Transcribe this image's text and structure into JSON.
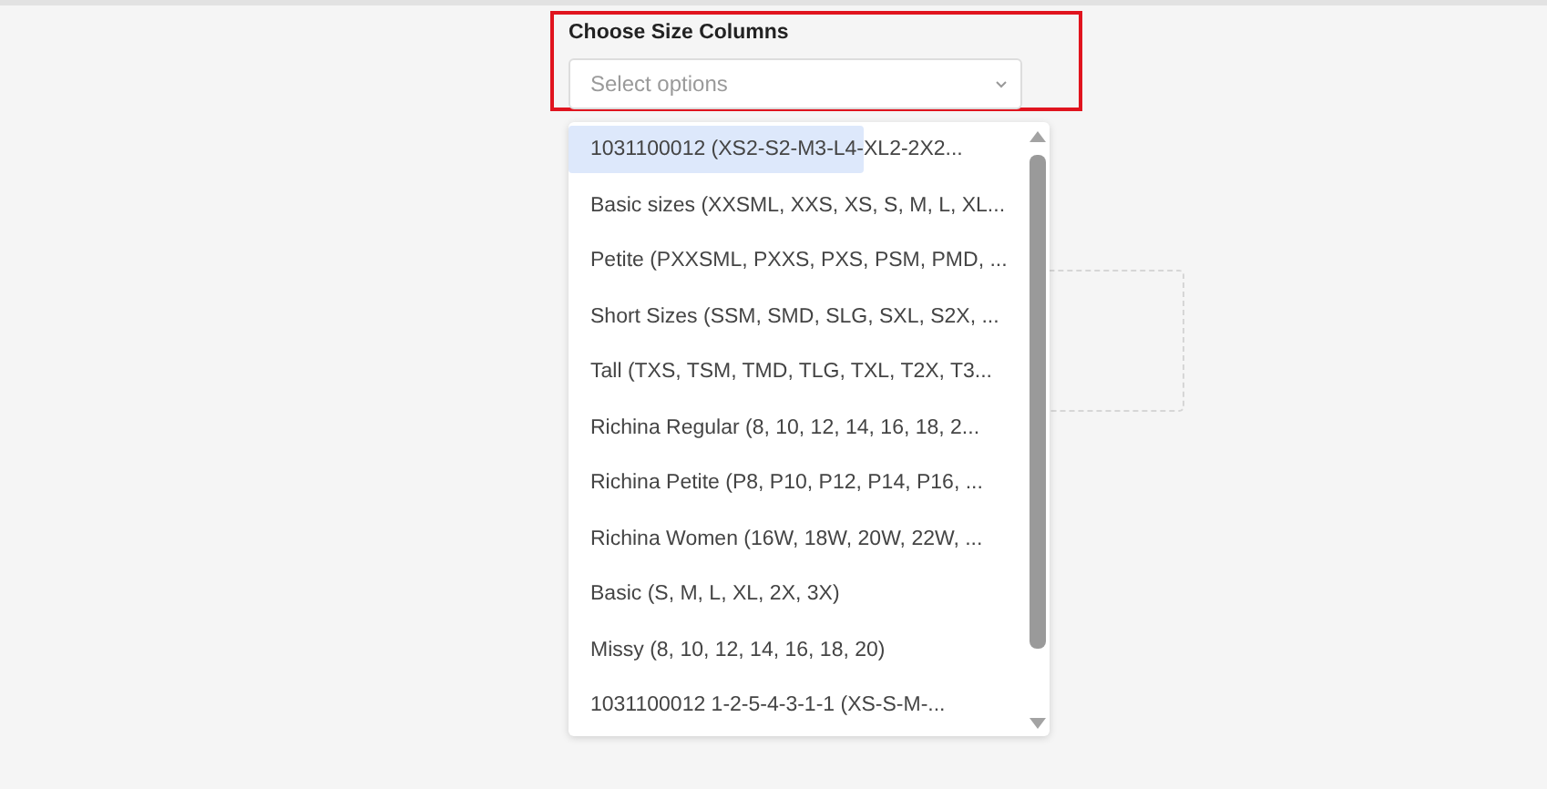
{
  "field": {
    "label": "Choose Size Columns",
    "placeholder": "Select options"
  },
  "options": [
    {
      "label": "1031100012 (XS2-S2-M3-L4-XL2-2X2...",
      "highlighted": true
    },
    {
      "label": "Basic sizes (XXSML, XXS, XS, S, M, L, XL...",
      "highlighted": false
    },
    {
      "label": "Petite (PXXSML, PXXS, PXS, PSM, PMD, ...",
      "highlighted": false
    },
    {
      "label": "Short Sizes (SSM, SMD, SLG, SXL, S2X, ...",
      "highlighted": false
    },
    {
      "label": "Tall (TXS, TSM, TMD, TLG, TXL, T2X, T3...",
      "highlighted": false
    },
    {
      "label": "Richina Regular (8, 10, 12, 14, 16, 18, 2...",
      "highlighted": false
    },
    {
      "label": "Richina Petite (P8, P10, P12, P14, P16, ...",
      "highlighted": false
    },
    {
      "label": "Richina Women (16W, 18W, 20W, 22W, ...",
      "highlighted": false
    },
    {
      "label": "Basic (S, M, L, XL, 2X, 3X)",
      "highlighted": false
    },
    {
      "label": "Missy (8, 10, 12, 14, 16, 18, 20)",
      "highlighted": false
    },
    {
      "label": "1031100012 1-2-5-4-3-1-1 (XS-S-M-...",
      "highlighted": false
    }
  ]
}
